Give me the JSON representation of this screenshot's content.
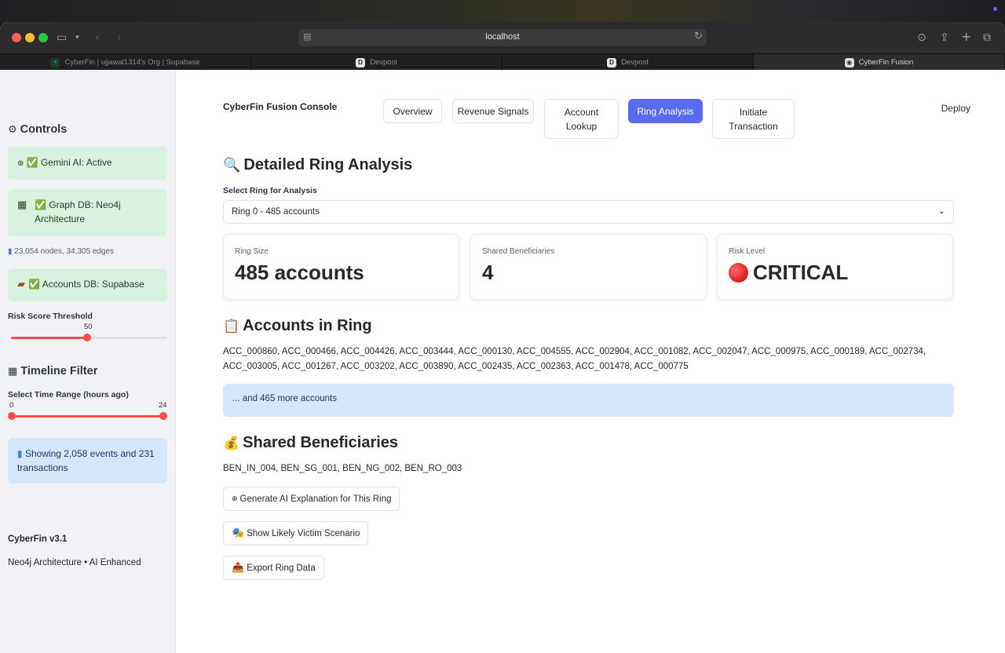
{
  "browser": {
    "url": "localhost",
    "tabs": [
      {
        "label": "CyberFin | ujjawal1314's Org | Supabase",
        "icon": "supabase-icon"
      },
      {
        "label": "Devpost",
        "icon": "devpost-icon"
      },
      {
        "label": "Devpost",
        "icon": "devpost-icon"
      },
      {
        "label": "CyberFin Fusion",
        "icon": "cyberfin-icon"
      }
    ]
  },
  "sidebar": {
    "controls_heading": "Controls",
    "status": {
      "gemini": "✅ Gemini AI: Active",
      "graph": "✅ Graph DB: Neo4j Architecture",
      "graph_stats": "23,054 nodes, 34,305 edges",
      "accounts": "✅ Accounts DB: Supabase"
    },
    "risk_threshold": {
      "label": "Risk Score Threshold",
      "value": "50",
      "fraction": 0.5
    },
    "timeline_heading": "Timeline Filter",
    "time_range": {
      "label": "Select Time Range (hours ago)",
      "min": "0",
      "max": "24"
    },
    "showing": "Showing 2,058 events and 231 transactions",
    "version": "CyberFin v3.1",
    "footer": "Neo4j Architecture • AI Enhanced"
  },
  "header": {
    "title": "CyberFin Fusion Console",
    "deploy": "Deploy",
    "tabs": {
      "overview": "Overview",
      "revenue": "Revenue Signals",
      "account_lookup": "Account Lookup",
      "ring_analysis": "Ring Analysis",
      "initiate": "Initiate Transaction"
    },
    "active_tab": "Ring Analysis"
  },
  "main": {
    "heading": "Detailed Ring Analysis",
    "select_label": "Select Ring for Analysis",
    "select_value": "Ring 0 - 485 accounts",
    "metrics": {
      "ring_size": {
        "label": "Ring Size",
        "value": "485 accounts"
      },
      "shared_beneficiaries": {
        "label": "Shared Beneficiaries",
        "value": "4"
      },
      "risk_level": {
        "label": "Risk Level",
        "value": "CRITICAL"
      }
    },
    "accounts_heading": "Accounts in Ring",
    "accounts_list": "ACC_000860, ACC_000466, ACC_004426, ACC_003444, ACC_000130, ACC_004555, ACC_002904, ACC_001082, ACC_002047, ACC_000975, ACC_000189, ACC_002734, ACC_003005, ACC_001267, ACC_003202, ACC_003890, ACC_002435, ACC_002363, ACC_001478, ACC_000775",
    "more_accounts": "... and 465 more accounts",
    "beneficiaries_heading": "Shared Beneficiaries",
    "beneficiaries_list": "BEN_IN_004, BEN_SG_001, BEN_NG_002, BEN_RO_003",
    "buttons": {
      "ai_explanation": "Generate AI Explanation for This Ring",
      "victim": "Show Likely Victim Scenario",
      "export": "Export Ring Data"
    }
  }
}
